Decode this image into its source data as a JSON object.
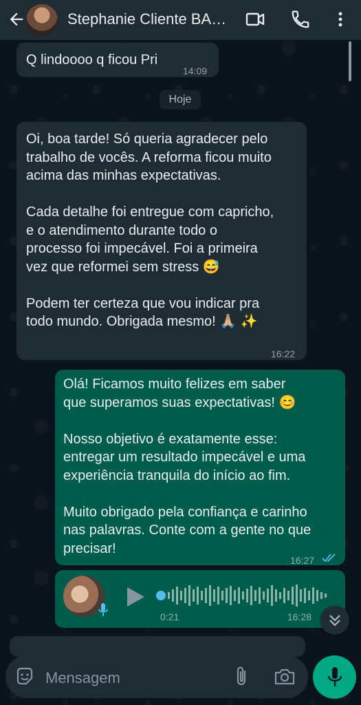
{
  "header": {
    "title": "Stephanie Cliente BA…",
    "icons": [
      "back-arrow-icon",
      "video-call-icon",
      "phone-icon",
      "more-options-icon"
    ]
  },
  "messages": {
    "partial_prev": {
      "text": "Q lindoooo q ficou Pri",
      "time": "14:09"
    },
    "date_chip": "Hoje",
    "incoming": {
      "paragraphs": [
        "Oi, boa tarde! Só queria agradecer pelo\ntrabalho de vocês. A reforma ficou muito\nacima das minhas expectativas.",
        "Cada detalhe foi entregue com capricho,\ne o atendimento durante todo o\nprocesso foi impecável. Foi a primeira\nvez que reformei sem stress 😅",
        "Podem ter certeza que vou indicar pra\ntodo mundo. Obrigada mesmo! 🙏🏼 ✨"
      ],
      "time": "16:22"
    },
    "outgoing": {
      "paragraphs": [
        "Olá! Ficamos muito felizes em saber\nque superamos suas expectativas! 😊",
        "Nosso objetivo é exatamente esse:\nentregar um resultado impecável e uma\nexperiência tranquila do início ao fim.",
        "Muito obrigado pela confiança e carinho\nnas palavras. Conte com a gente no que\nprecisar!"
      ],
      "time": "16:27",
      "status": "read"
    },
    "voice": {
      "duration": "0:21",
      "time": "16:28",
      "progress": 0
    }
  },
  "composer": {
    "placeholder": "Mensagem"
  },
  "colors": {
    "header": "#1f2c33",
    "incoming_bubble": "#202c33",
    "outgoing_bubble": "#005c4b",
    "accent_green": "#00a884",
    "read_ticks": "#53bdeb"
  }
}
